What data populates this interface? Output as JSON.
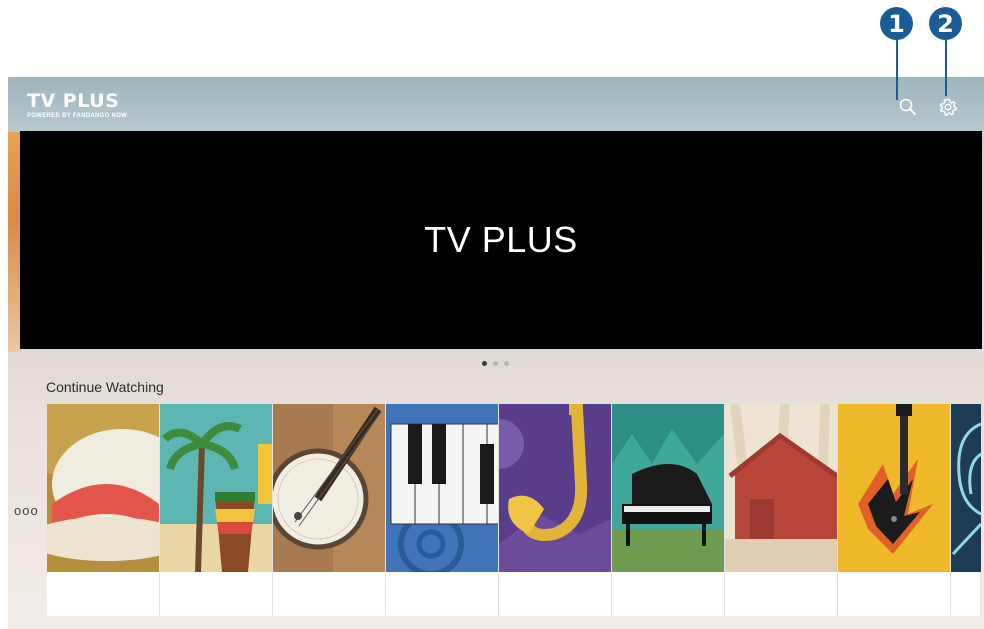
{
  "app": {
    "logo_text": "TV PLUS",
    "logo_subtext": "POWERED BY FANDANGO NOW"
  },
  "header": {
    "search_icon": "search-icon",
    "settings_icon": "gear-icon"
  },
  "callouts": [
    "1",
    "2"
  ],
  "hero": {
    "title": "TV PLUS",
    "page_count": 3,
    "active_page": 1
  },
  "continue_watching": {
    "title": "Continue Watching",
    "more_label": "ooo",
    "items": [
      {
        "art": "straw-hat"
      },
      {
        "art": "palm-drum"
      },
      {
        "art": "banjo"
      },
      {
        "art": "piano-keys"
      },
      {
        "art": "saxophone"
      },
      {
        "art": "grand-piano"
      },
      {
        "art": "barn"
      },
      {
        "art": "electric-guitar"
      },
      {
        "art": "neon-figure"
      }
    ]
  },
  "colors": {
    "callout": "#1a5c96",
    "hero_bg": "#000000"
  }
}
